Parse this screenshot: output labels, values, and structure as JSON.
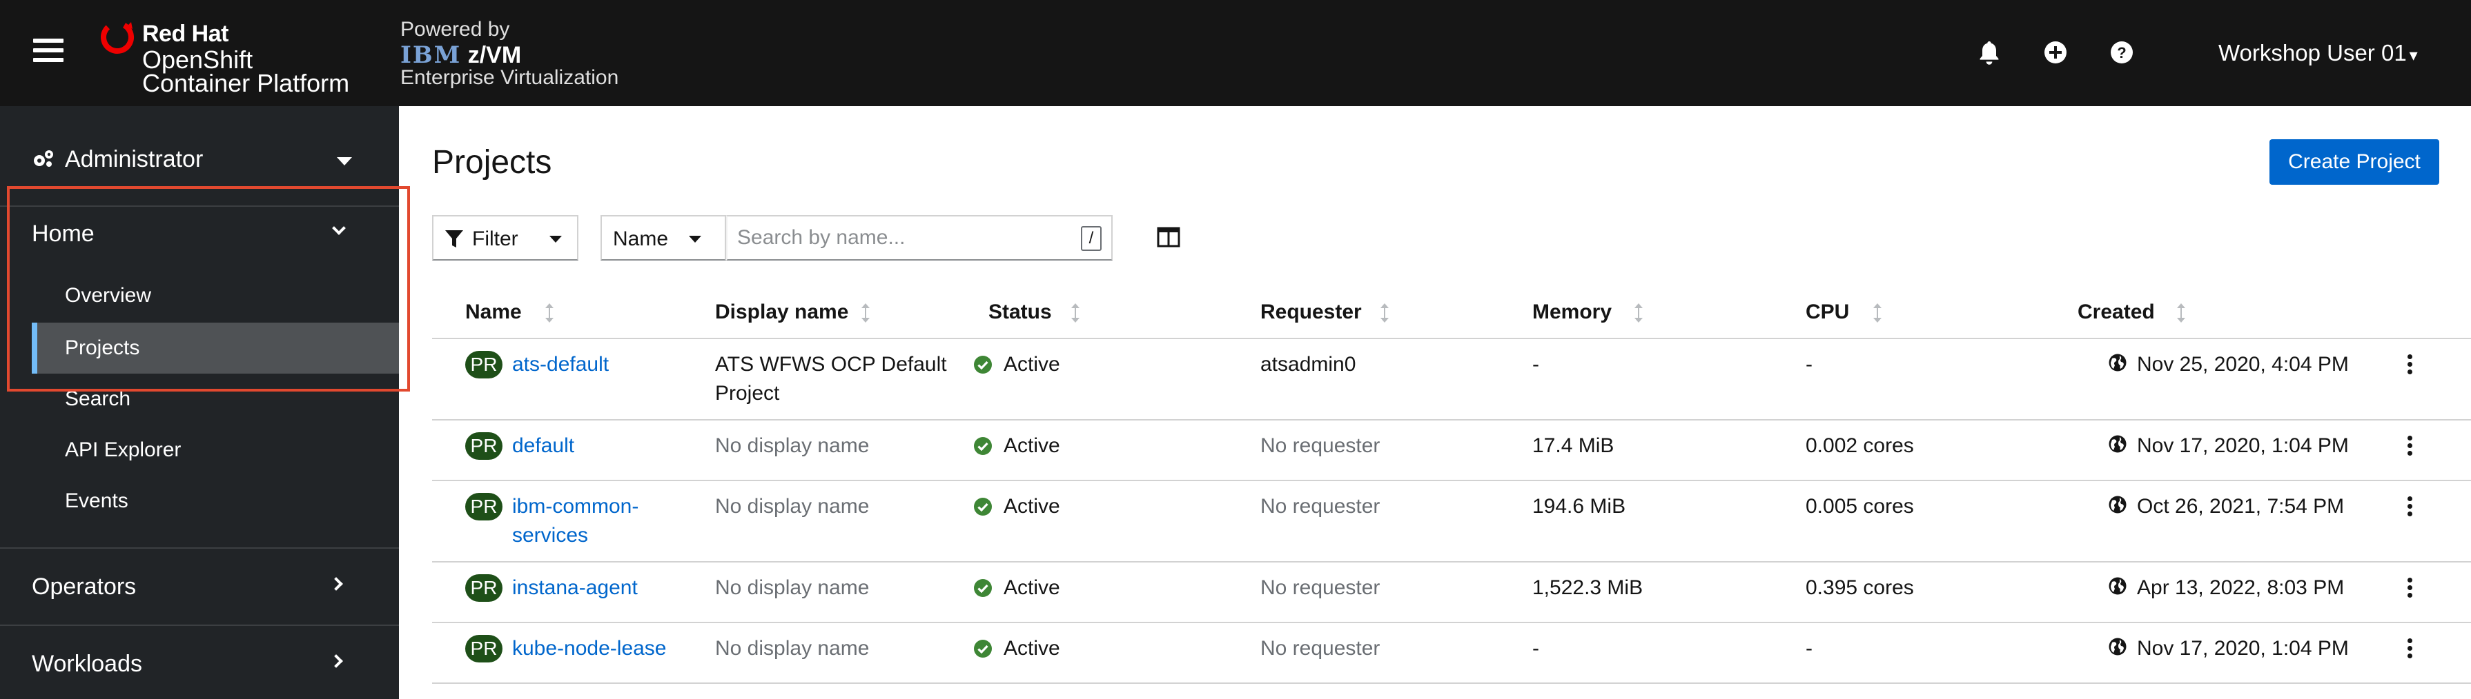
{
  "masthead": {
    "brand_line1": "Red Hat",
    "brand_line2": "OpenShift",
    "brand_line3": "Container Platform",
    "powered_line1": "Powered by",
    "powered_ibm": "IBM",
    "powered_zvm": "z/VM",
    "powered_line3": "Enterprise Virtualization",
    "user": "Workshop User 01",
    "icons": [
      "hamburger-icon",
      "notification-bell-icon",
      "plus-circle-icon",
      "help-icon"
    ]
  },
  "sidebar": {
    "perspective": "Administrator",
    "home": {
      "title": "Home",
      "items": [
        {
          "label": "Overview",
          "active": false
        },
        {
          "label": "Projects",
          "active": true
        },
        {
          "label": "Search",
          "active": false
        },
        {
          "label": "API Explorer",
          "active": false
        },
        {
          "label": "Events",
          "active": false
        }
      ]
    },
    "operators": "Operators",
    "workloads": "Workloads",
    "accent_color": "#73bcf7",
    "highlight_color": "#e2492f"
  },
  "main": {
    "title": "Projects",
    "create_button": "Create Project",
    "filter_label": "Filter",
    "name_filter": "Name",
    "search_placeholder": "Search by name...",
    "search_shortcut": "/",
    "columns": [
      "Name",
      "Display name",
      "Status",
      "Requester",
      "Memory",
      "CPU",
      "Created"
    ],
    "badge": "PR",
    "rows": [
      {
        "name": [
          "ats-default"
        ],
        "display_name": [
          "ATS WFWS OCP Default",
          "Project"
        ],
        "display_muted": false,
        "status": "Active",
        "requester": "atsadmin0",
        "requester_muted": false,
        "memory": "-",
        "cpu": "-",
        "created": "Nov 25, 2020, 4:04 PM"
      },
      {
        "name": [
          "default"
        ],
        "display_name": [
          "No display name"
        ],
        "display_muted": true,
        "status": "Active",
        "requester": "No requester",
        "requester_muted": true,
        "memory": "17.4 MiB",
        "cpu": "0.002 cores",
        "created": "Nov 17, 2020, 1:04 PM"
      },
      {
        "name": [
          "ibm-common-",
          "services"
        ],
        "display_name": [
          "No display name"
        ],
        "display_muted": true,
        "status": "Active",
        "requester": "No requester",
        "requester_muted": true,
        "memory": "194.6 MiB",
        "cpu": "0.005 cores",
        "created": "Oct 26, 2021, 7:54 PM"
      },
      {
        "name": [
          "instana-agent"
        ],
        "display_name": [
          "No display name"
        ],
        "display_muted": true,
        "status": "Active",
        "requester": "No requester",
        "requester_muted": true,
        "memory": "1,522.3 MiB",
        "cpu": "0.395 cores",
        "created": "Apr 13, 2022, 8:03 PM"
      },
      {
        "name": [
          "kube-node-lease"
        ],
        "display_name": [
          "No display name"
        ],
        "display_muted": true,
        "status": "Active",
        "requester": "No requester",
        "requester_muted": true,
        "memory": "-",
        "cpu": "-",
        "created": "Nov 17, 2020, 1:04 PM"
      }
    ],
    "status_color": "#3e8635",
    "link_color": "#0066cc",
    "badge_color": "#1e4f18"
  }
}
